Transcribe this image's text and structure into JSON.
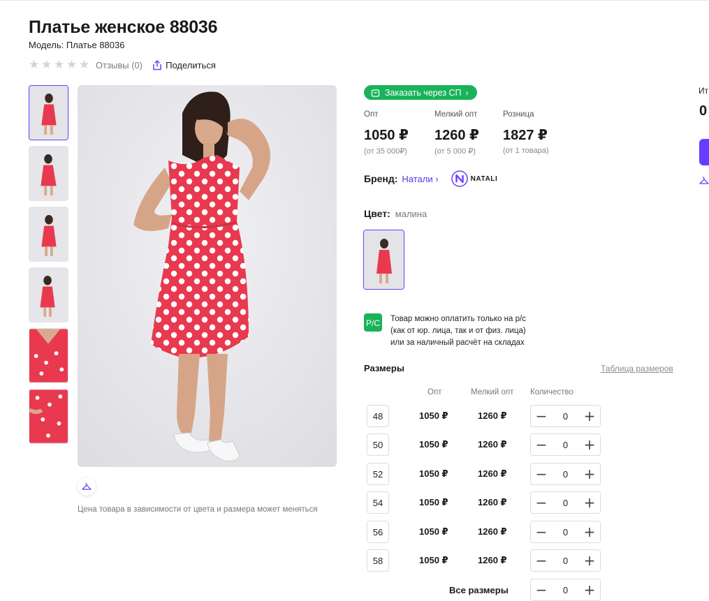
{
  "product": {
    "title": "Платье женское 88036",
    "model": "Модель: Платье 88036",
    "reviews": "Отзывы (0)",
    "share": "Поделиться",
    "price_note": "Цена товара в зависимости от цвета и размера может меняться"
  },
  "order_sp": {
    "label": "Заказать через СП",
    "color": "#19b35a"
  },
  "prices": [
    {
      "label": "Опт",
      "value": "1050 ₽",
      "sub": "(от 35 000₽)"
    },
    {
      "label": "Мелкий опт",
      "value": "1260 ₽",
      "sub": "(от 5 000 ₽)"
    },
    {
      "label": "Розница",
      "value": "1827 ₽",
      "sub": "(от 1 товара)"
    }
  ],
  "brand": {
    "label": "Бренд:",
    "name": "Натали",
    "logo_text": "NATALI"
  },
  "color": {
    "label": "Цвет:",
    "value": "малина"
  },
  "payment": {
    "icon": "P/C",
    "lines": [
      "Товар можно оплатить только на р/с",
      "(как от юр. лица, так и от физ. лица)",
      "или за наличный расчёт на складах"
    ]
  },
  "sizes": {
    "title": "Размеры",
    "table_link": "Таблица размеров",
    "headers": {
      "opt": "Опт",
      "small": "Мелкий опт",
      "qty": "Количество"
    },
    "rows": [
      {
        "size": "48",
        "opt": "1050 ₽",
        "small": "1260 ₽",
        "qty": "0"
      },
      {
        "size": "50",
        "opt": "1050 ₽",
        "small": "1260 ₽",
        "qty": "0"
      },
      {
        "size": "52",
        "opt": "1050 ₽",
        "small": "1260 ₽",
        "qty": "0"
      },
      {
        "size": "54",
        "opt": "1050 ₽",
        "small": "1260 ₽",
        "qty": "0"
      },
      {
        "size": "56",
        "opt": "1050 ₽",
        "small": "1260 ₽",
        "qty": "0"
      },
      {
        "size": "58",
        "opt": "1050 ₽",
        "small": "1260 ₽",
        "qty": "0"
      }
    ],
    "all_label": "Все размеры",
    "all_qty": "0"
  },
  "right_panel": {
    "partial_label": "Ит",
    "total": "0"
  },
  "colors": {
    "accent": "#6a3cff",
    "green": "#19b35a",
    "dress": "#e8394f"
  }
}
